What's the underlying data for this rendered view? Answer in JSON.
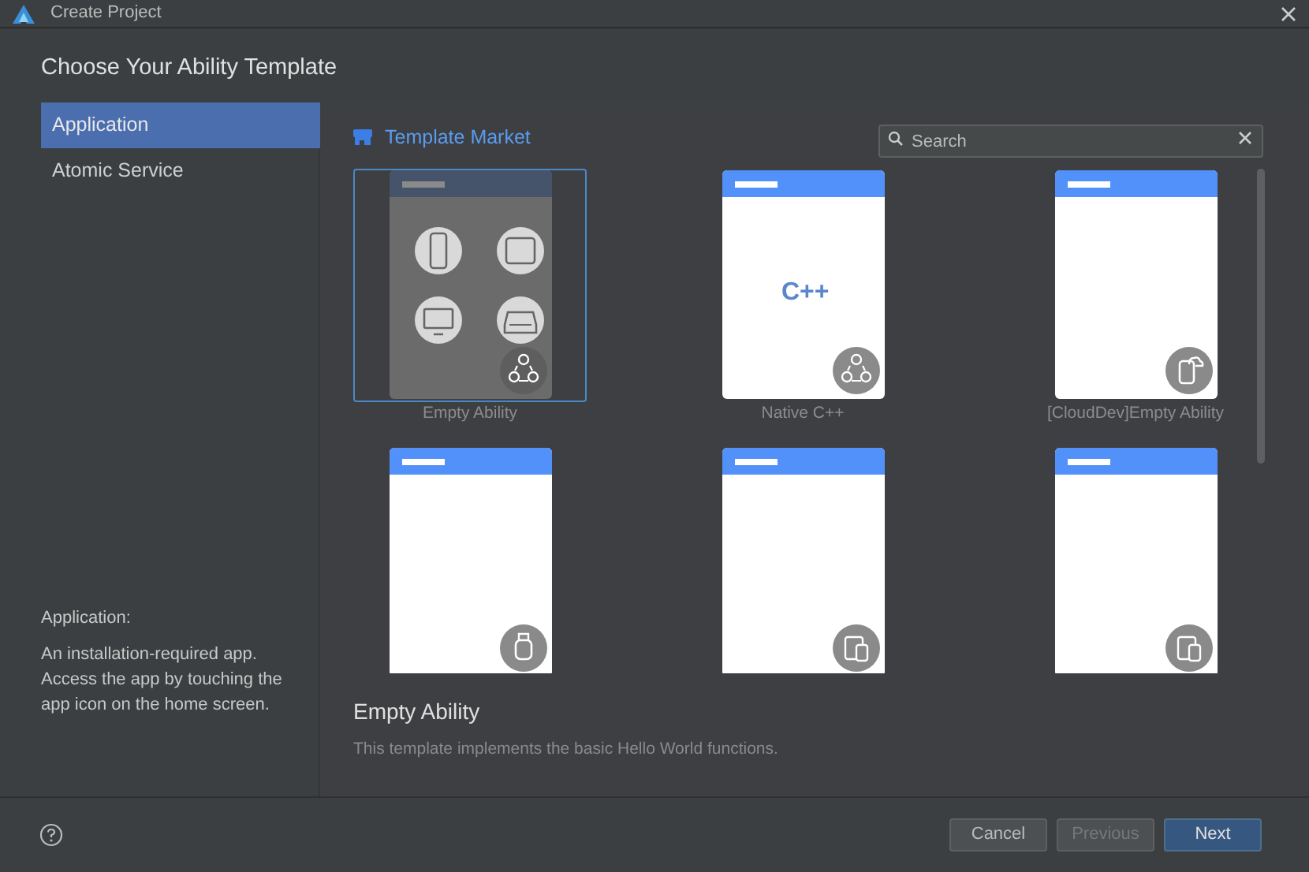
{
  "window": {
    "title": "Create Project"
  },
  "heading": "Choose Your Ability Template",
  "sidebar": {
    "items": [
      {
        "label": "Application",
        "selected": true
      },
      {
        "label": "Atomic Service",
        "selected": false
      }
    ],
    "description_title": "Application:",
    "description": "An installation-required app. Access the app by touching the app icon on the home screen."
  },
  "market": {
    "title": "Template Market"
  },
  "search": {
    "placeholder": "Search"
  },
  "templates": [
    {
      "label": "Empty Ability",
      "selected": true,
      "preview": {
        "kind": "devices"
      },
      "badge": {
        "kind": "nodes"
      }
    },
    {
      "label": "Native C++",
      "selected": false,
      "preview": {
        "kind": "cpp",
        "logo": "C++"
      },
      "badge": {
        "kind": "nodes"
      }
    },
    {
      "label": "[CloudDev]Empty Ability",
      "selected": false,
      "preview": {
        "kind": "blank"
      },
      "badge": {
        "kind": "cloudphone"
      }
    },
    {
      "selected": false,
      "preview": {
        "kind": "blank"
      },
      "badge": {
        "kind": "watch"
      }
    },
    {
      "selected": false,
      "preview": {
        "kind": "blank"
      },
      "badge": {
        "kind": "tablet"
      }
    },
    {
      "selected": false,
      "preview": {
        "kind": "blank"
      },
      "badge": {
        "kind": "tablet"
      }
    }
  ],
  "details": {
    "title": "Empty Ability",
    "text": "This template implements the basic Hello World functions."
  },
  "buttons": [
    {
      "label": "Cancel",
      "kind": "normal",
      "disabled": false
    },
    {
      "label": "Previous",
      "kind": "normal",
      "disabled": true
    },
    {
      "label": "Next",
      "kind": "primary",
      "disabled": false
    }
  ]
}
